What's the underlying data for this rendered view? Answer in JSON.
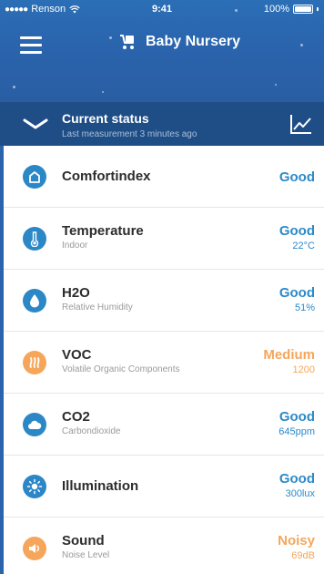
{
  "status_bar": {
    "carrier": "Renson",
    "time": "9:41",
    "battery": "100%"
  },
  "header": {
    "title": "Baby Nursery",
    "icons": [
      "menu-icon",
      "stroller-icon"
    ]
  },
  "current_status": {
    "title": "Current status",
    "subtitle": "Last measurement 3 minutes ago",
    "icons": [
      "chevron-down-icon",
      "chart-icon"
    ]
  },
  "colors": {
    "header_blue": "#2a64ad",
    "status_bar_blue": "#1f4e87",
    "good": "#2b8ac9",
    "warning": "#f5a65b"
  },
  "metrics": [
    {
      "name": "Comfortindex",
      "desc": "",
      "status": "Good",
      "value": "",
      "icon": "home-icon",
      "level": "good"
    },
    {
      "name": "Temperature",
      "desc": "Indoor",
      "status": "Good",
      "value": "22°C",
      "icon": "thermometer-icon",
      "level": "good"
    },
    {
      "name": "H2O",
      "desc": "Relative Humidity",
      "status": "Good",
      "value": "51%",
      "icon": "droplet-icon",
      "level": "good"
    },
    {
      "name": "VOC",
      "desc": "Volatile Organic Components",
      "status": "Medium",
      "value": "1200",
      "icon": "fumes-icon",
      "level": "warn"
    },
    {
      "name": "CO2",
      "desc": "Carbondioxide",
      "status": "Good",
      "value": "645ppm",
      "icon": "cloud-icon",
      "level": "good"
    },
    {
      "name": "Illumination",
      "desc": "",
      "status": "Good",
      "value": "300lux",
      "icon": "sun-icon",
      "level": "good"
    },
    {
      "name": "Sound",
      "desc": "Noise Level",
      "status": "Noisy",
      "value": "69dB",
      "icon": "speaker-icon",
      "level": "warn"
    }
  ]
}
